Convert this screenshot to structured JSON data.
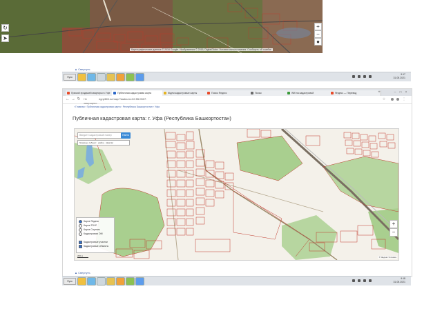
{
  "top_screenshot": {
    "map_attribution": "Картографические данные © 2016 Google. Изображения © 2016, DigitalGlobe. Условия использования. Сообщить об ошибке",
    "zoom_in": "+",
    "zoom_out": "−",
    "collapse_label": "▲ Свернуть"
  },
  "taskbar_top": {
    "start_label": "Пуск",
    "clock_time": "9:17",
    "clock_date": "31.05.2021"
  },
  "browser": {
    "tabs": [
      {
        "label": "Прямой продажей квартиры в Уфе",
        "color": "#e84b2a"
      },
      {
        "label": "Публичная кадастровая карта",
        "color": "#2a66c8",
        "active": true
      },
      {
        "label": "Ждем кадастровые карты",
        "color": "#e6b422"
      },
      {
        "label": "Поиск Яндекс",
        "color": "#e84b2a"
      },
      {
        "label": "Поиск",
        "color": "#6a6a6a"
      },
      {
        "label": "Wifi на кадастровой",
        "color": "#3a9a3a"
      },
      {
        "label": "Яндекс — Перевод",
        "color": "#e84b2a"
      }
    ],
    "url": "egrp365.ru/map/?kadnum=02:55:0507:",
    "lock_label": "Не защищено",
    "breadcrumbs": "‹ Главная  ›  Публичная кадастровая карта  ›  Республика Башкортостан  ›  Уфа",
    "page_title": "Публичная кадастровая карта: г. Уфа (Республика Башкортостан)"
  },
  "cadastral_map": {
    "search_placeholder": "Введите кадастровый номер",
    "find_button": "Найти",
    "region_select": "Границы: субъект · район · квартал",
    "layers": [
      {
        "label": "Карта Яндекс",
        "kind": "radio",
        "checked": true
      },
      {
        "label": "Карта 2ГИС",
        "kind": "radio",
        "checked": false
      },
      {
        "label": "Карта Спутник",
        "kind": "radio",
        "checked": false
      },
      {
        "label": "Кадастровая ОМ",
        "kind": "radio",
        "checked": false
      },
      {
        "label": "Кадастровые участки",
        "kind": "checkbox",
        "checked": true
      },
      {
        "label": "Кадастровые объекты",
        "kind": "checkbox",
        "checked": true
      }
    ],
    "zoom_in": "+",
    "zoom_out": "−",
    "scale": "200 м",
    "attribution": "© Яндекс  Условия"
  },
  "taskbar_bottom": {
    "start_label": "Пуск",
    "clock_time": "9:18",
    "clock_date": "31.05.2021",
    "collapse_label": "▲ Свернуть"
  },
  "colors": {
    "parcel_red": "#c0392b",
    "forest_green": "#a9cf8f",
    "water_blue": "#7fb1d9",
    "button_blue": "#3a8ad6"
  }
}
